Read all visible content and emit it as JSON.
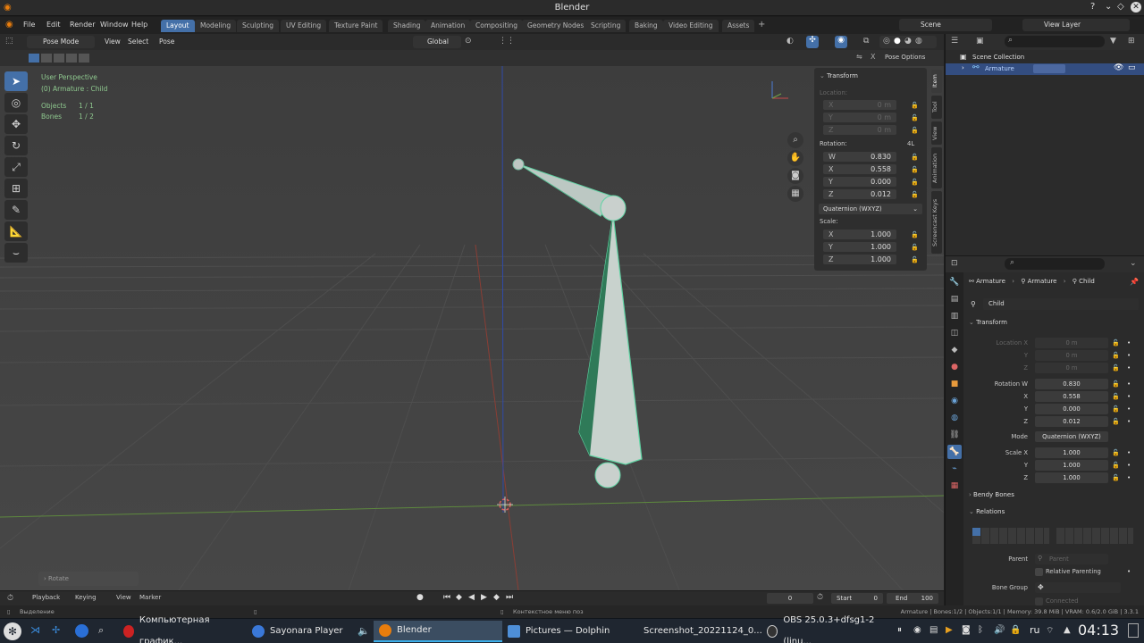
{
  "window": {
    "title": "Blender"
  },
  "menus": [
    "File",
    "Edit",
    "Render",
    "Window",
    "Help"
  ],
  "workspaces": [
    "Layout",
    "Modeling",
    "Sculpting",
    "UV Editing",
    "Texture Paint",
    "Shading",
    "Animation",
    "Compositing",
    "Geometry Nodes",
    "Scripting",
    "Baking",
    "Video Editing",
    "Assets"
  ],
  "scene_field": "Scene",
  "view_layer_field": "View Layer",
  "viewport_header": {
    "mode": "Pose Mode",
    "menus": [
      "View",
      "Select",
      "Pose"
    ],
    "orientation": "Global",
    "pose_options": "Pose Options"
  },
  "overlay": {
    "perspective": "User Perspective",
    "object": "(0) Armature : Child",
    "objects_label": "Objects",
    "objects_value": "1 / 1",
    "bones_label": "Bones",
    "bones_value": "1 / 2",
    "last_op": "Rotate"
  },
  "npanel": {
    "section": "Transform",
    "location_label": "Location:",
    "location": [
      {
        "k": "X",
        "v": "0 m"
      },
      {
        "k": "Y",
        "v": "0 m"
      },
      {
        "k": "Z",
        "v": "0 m"
      }
    ],
    "rotation_label": "Rotation:",
    "rotation_mode_short": "4L",
    "rotation": [
      {
        "k": "W",
        "v": "0.830"
      },
      {
        "k": "X",
        "v": "0.558"
      },
      {
        "k": "Y",
        "v": "0.000"
      },
      {
        "k": "Z",
        "v": "0.012"
      }
    ],
    "rotation_mode": "Quaternion (WXYZ)",
    "scale_label": "Scale:",
    "scale": [
      {
        "k": "X",
        "v": "1.000"
      },
      {
        "k": "Y",
        "v": "1.000"
      },
      {
        "k": "Z",
        "v": "1.000"
      }
    ],
    "side_tabs": [
      "Item",
      "Tool",
      "View",
      "Animation",
      "Screencast Keys"
    ]
  },
  "outliner": {
    "collection": "Scene Collection",
    "item": "Armature"
  },
  "properties": {
    "breadcrumb": [
      "Armature",
      "Armature",
      "Child"
    ],
    "bone_name": "Child",
    "transform_label": "Transform",
    "location_rows": [
      {
        "k": "Location X",
        "v": "0 m"
      },
      {
        "k": "Y",
        "v": "0 m"
      },
      {
        "k": "Z",
        "v": "0 m"
      }
    ],
    "rotation_rows": [
      {
        "k": "Rotation W",
        "v": "0.830"
      },
      {
        "k": "X",
        "v": "0.558"
      },
      {
        "k": "Y",
        "v": "0.000"
      },
      {
        "k": "Z",
        "v": "0.012"
      }
    ],
    "mode_label": "Mode",
    "mode_value": "Quaternion (WXYZ)",
    "scale_rows": [
      {
        "k": "Scale X",
        "v": "1.000"
      },
      {
        "k": "Y",
        "v": "1.000"
      },
      {
        "k": "Z",
        "v": "1.000"
      }
    ],
    "bendy_bones": "Bendy Bones",
    "relations": "Relations",
    "parent_label": "Parent",
    "parent_placeholder": "Parent",
    "relative_parenting": "Relative Parenting",
    "bone_group_label": "Bone Group",
    "connected": "Connected"
  },
  "timeline": {
    "menus": [
      "Playback",
      "Keying",
      "View",
      "Marker"
    ],
    "frame": "0",
    "start_label": "Start",
    "start": "0",
    "end_label": "End",
    "end": "100"
  },
  "statusbar": {
    "left": "Выделение",
    "mid": "Контекстное меню поз",
    "right": "Armature | Bones:1/2 | Objects:1/1 | Memory: 39.8 MiB | VRAM: 0.6/2.0 GiB | 3.3.1"
  },
  "taskbar": {
    "tasks": [
      "Компьютерная график...",
      "Sayonara Player",
      "Blender",
      "Pictures — Dolphin",
      "Screenshot_20221124_0...",
      "OBS 25.0.3+dfsg1-2 (linu..."
    ],
    "lang": "ru",
    "clock": "04:13"
  }
}
